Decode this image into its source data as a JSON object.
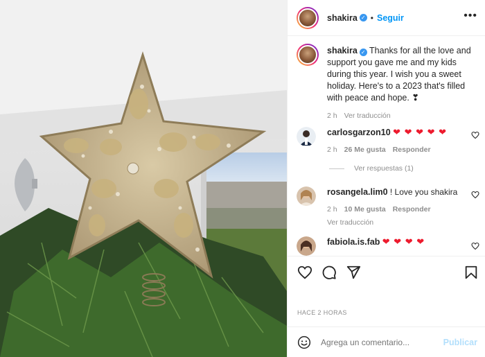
{
  "post": {
    "username": "shakira",
    "follow_label": "Seguir",
    "more_label": "•••",
    "caption": "Thanks for all the love and support you gave me and my kids during this year. I wish you a sweet holiday. Here's to a 2023 that's filled with peace and hope. ❣",
    "caption_time": "2 h",
    "caption_translate": "Ver traducción",
    "time_ago": "HACE 2 HORAS"
  },
  "comments": [
    {
      "username": "carlosgarzon10",
      "text": "❤ ❤ ❤ ❤ ❤",
      "time": "2 h",
      "likes": "26 Me gusta",
      "reply": "Responder",
      "replies_label": "Ver respuestas (1)"
    },
    {
      "username": "rosangela.lim0",
      "text": "! Love you shakira",
      "time": "2 h",
      "likes": "10 Me gusta",
      "reply": "Responder",
      "translate": "Ver traducción"
    },
    {
      "username": "fabiola.is.fab",
      "text": "❤ ❤ ❤ ❤"
    }
  ],
  "add_comment": {
    "placeholder": "Agrega un comentario...",
    "post_label": "Publicar"
  },
  "colors": {
    "link_blue": "#0095f6",
    "verified_blue": "#3897f0",
    "heart_red": "#ed1b2e",
    "muted": "#8e8e8e"
  },
  "icons": {
    "like": "heart-icon",
    "comment": "comment-icon",
    "share": "send-icon",
    "save": "bookmark-icon",
    "emoji": "smile-icon"
  }
}
